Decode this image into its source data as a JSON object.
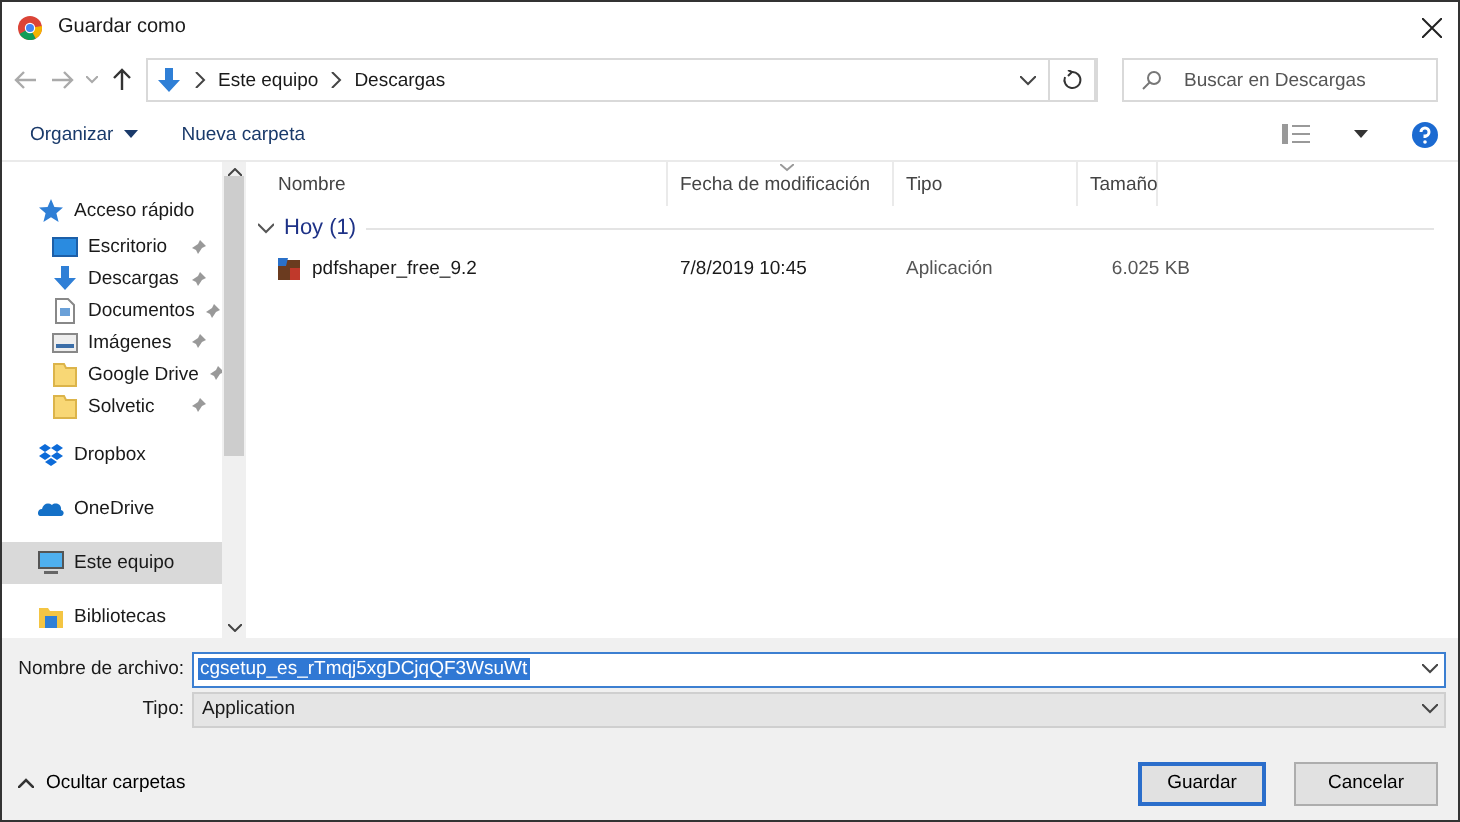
{
  "window": {
    "title": "Guardar como"
  },
  "address": {
    "crumbs": [
      "Este equipo",
      "Descargas"
    ],
    "search_placeholder": "Buscar en Descargas"
  },
  "toolbar": {
    "organize": "Organizar",
    "new_folder": "Nueva carpeta"
  },
  "sidebar": {
    "items": [
      {
        "label": "Acceso rápido",
        "kind": "star",
        "pinned": false,
        "selected": false
      },
      {
        "label": "Escritorio",
        "kind": "desktop",
        "pinned": true,
        "selected": false
      },
      {
        "label": "Descargas",
        "kind": "download",
        "pinned": true,
        "selected": false
      },
      {
        "label": "Documentos",
        "kind": "document",
        "pinned": true,
        "selected": false
      },
      {
        "label": "Imágenes",
        "kind": "image",
        "pinned": true,
        "selected": false
      },
      {
        "label": "Google Drive",
        "kind": "folder",
        "pinned": true,
        "selected": false
      },
      {
        "label": "Solvetic",
        "kind": "folder",
        "pinned": true,
        "selected": false
      },
      {
        "label": "Dropbox",
        "kind": "dropbox",
        "pinned": false,
        "selected": false
      },
      {
        "label": "OneDrive",
        "kind": "cloud",
        "pinned": false,
        "selected": false
      },
      {
        "label": "Este equipo",
        "kind": "computer",
        "pinned": false,
        "selected": true
      },
      {
        "label": "Bibliotecas",
        "kind": "library",
        "pinned": false,
        "selected": false
      }
    ]
  },
  "table": {
    "columns": [
      {
        "label": "Nombre",
        "sorted": false
      },
      {
        "label": "Fecha de modificación",
        "sorted": true
      },
      {
        "label": "Tipo",
        "sorted": false
      },
      {
        "label": "Tamaño",
        "sorted": false
      }
    ],
    "groups": [
      {
        "label": "Hoy (1)",
        "expanded": true,
        "rows": [
          {
            "name": "pdfshaper_free_9.2",
            "date": "7/8/2019 10:45",
            "type": "Aplicación",
            "size": "6.025 KB"
          }
        ]
      }
    ]
  },
  "form": {
    "filename_label": "Nombre de archivo:",
    "filename": "cgsetup_es_rTmqj5xgDCjqQF3WsuWt",
    "type_label": "Tipo:",
    "type": "Application"
  },
  "footer": {
    "hide_folders": "Ocultar carpetas",
    "save": "Guardar",
    "cancel": "Cancelar"
  }
}
